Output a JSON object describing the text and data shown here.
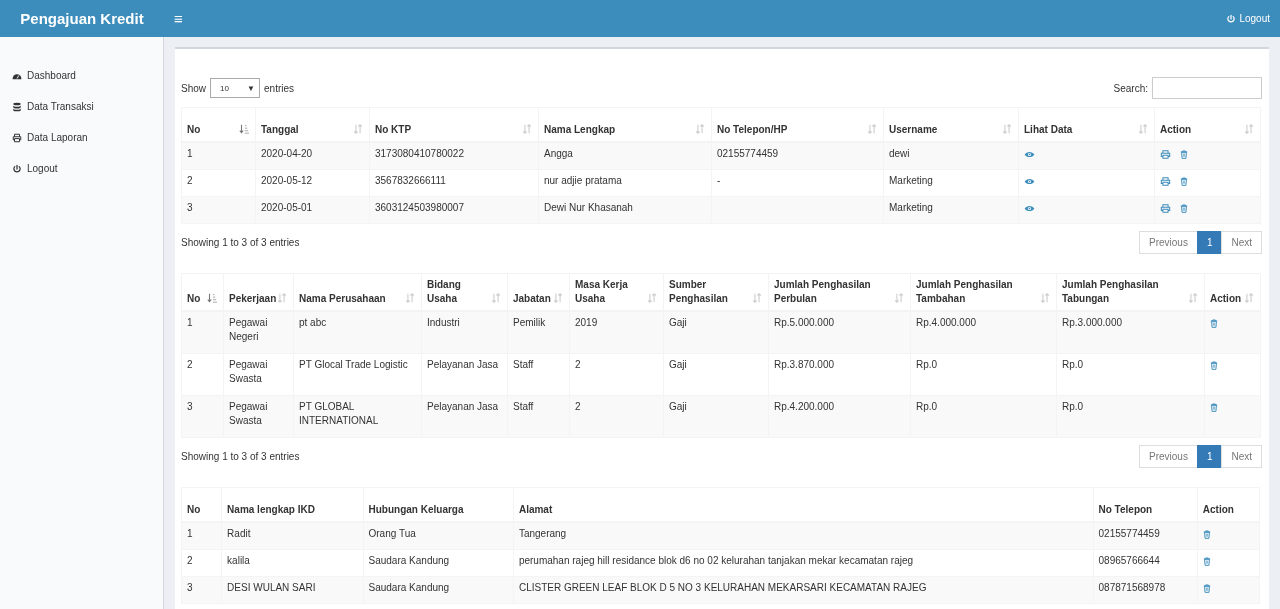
{
  "header": {
    "brand": "Pengajuan Kredit",
    "menu_toggle": "≡",
    "logout": "Logout"
  },
  "sidebar": {
    "items": [
      {
        "label": "Dashboard"
      },
      {
        "label": "Data Transaksi"
      },
      {
        "label": "Data Laporan"
      },
      {
        "label": "Logout"
      }
    ]
  },
  "controls": {
    "show_label": "Show",
    "length_value": "10",
    "length_caret": "▼",
    "entries_label": "entries",
    "search_label": "Search:"
  },
  "tables": [
    {
      "columns": [
        {
          "label": "No",
          "sorted": true,
          "kind": "text"
        },
        {
          "label": "Tanggal",
          "sorted": false,
          "kind": "text"
        },
        {
          "label": "No KTP",
          "sorted": false,
          "kind": "text"
        },
        {
          "label": "Nama Lengkap",
          "sorted": false,
          "kind": "text"
        },
        {
          "label": "No Telepon/HP",
          "sorted": false,
          "kind": "text"
        },
        {
          "label": "Username",
          "sorted": false,
          "kind": "text"
        },
        {
          "label": "Lihat Data",
          "sorted": false,
          "kind": "view"
        },
        {
          "label": "Action",
          "sorted": false,
          "kind": "print_delete"
        }
      ],
      "rows": [
        [
          "1",
          "2020-04-20",
          "3173080410780022",
          "Angga",
          "02155774459",
          "dewi"
        ],
        [
          "2",
          "2020-05-12",
          "3567832666111",
          "nur adjie pratama",
          "-",
          "Marketing"
        ],
        [
          "3",
          "2020-05-01",
          "3603124503980007",
          "Dewi Nur Khasanah",
          null,
          "Marketing"
        ]
      ],
      "info": "Showing 1 to 3 of 3 entries",
      "pagination": {
        "previous": {
          "label": "Previous",
          "disabled": true
        },
        "pages": [
          {
            "label": "1",
            "selected": true
          }
        ],
        "next": {
          "label": "Next",
          "disabled": true
        }
      }
    },
    {
      "columns": [
        {
          "label": "No",
          "sorted": true,
          "kind": "text"
        },
        {
          "label": "Pekerjaan",
          "sorted": false,
          "kind": "text"
        },
        {
          "label": "Nama Perusahaan",
          "sorted": false,
          "kind": "text"
        },
        {
          "label": "Bidang Usaha",
          "sorted": false,
          "kind": "text"
        },
        {
          "label": "Jabatan",
          "sorted": false,
          "kind": "text"
        },
        {
          "label": "Masa Kerja Usaha",
          "sorted": false,
          "kind": "text"
        },
        {
          "label": "Sumber Penghasilan",
          "sorted": false,
          "kind": "text"
        },
        {
          "label": "Jumlah Penghasilan Perbulan",
          "sorted": false,
          "kind": "text"
        },
        {
          "label": "Jumlah Penghasilan Tambahan",
          "sorted": false,
          "kind": "text"
        },
        {
          "label": "Jumlah Penghasilan Tabungan",
          "sorted": false,
          "kind": "text"
        },
        {
          "label": "Action",
          "sorted": false,
          "kind": "delete"
        }
      ],
      "rows": [
        [
          "1",
          "Pegawai Negeri",
          "pt abc",
          "Industri",
          "Pemilik",
          "2019",
          "Gaji",
          "Rp.5.000.000",
          "Rp.4.000.000",
          "Rp.3.000.000"
        ],
        [
          "2",
          "Pegawai Swasta",
          "PT Glocal Trade Logistic",
          "Pelayanan Jasa",
          "Staff",
          "2",
          "Gaji",
          "Rp.3.870.000",
          "Rp.0",
          "Rp.0"
        ],
        [
          "3",
          "Pegawai Swasta",
          "PT GLOBAL INTERNATIONAL",
          "Pelayanan Jasa",
          "Staff",
          "2",
          "Gaji",
          "Rp.4.200.000",
          "Rp.0",
          "Rp.0"
        ]
      ],
      "info": "Showing 1 to 3 of 3 entries",
      "pagination": {
        "previous": {
          "label": "Previous",
          "disabled": true
        },
        "pages": [
          {
            "label": "1",
            "selected": true
          }
        ],
        "next": {
          "label": "Next",
          "disabled": true
        }
      }
    },
    {
      "columns": [
        {
          "label": "No",
          "kind": "text"
        },
        {
          "label": "Nama lengkap IKD",
          "kind": "text"
        },
        {
          "label": "Hubungan Keluarga",
          "kind": "text"
        },
        {
          "label": "Alamat",
          "kind": "text"
        },
        {
          "label": "No Telepon",
          "kind": "text"
        },
        {
          "label": "Action",
          "kind": "delete"
        }
      ],
      "rows": [
        [
          "1",
          "Radit",
          "Orang Tua",
          "Tangerang",
          "02155774459"
        ],
        [
          "2",
          "kalila",
          "Saudara Kandung",
          "perumahan rajeg hill residance blok d6 no 02 kelurahan tanjakan mekar kecamatan rajeg",
          "08965766644"
        ],
        [
          "3",
          "DESI WULAN SARI",
          "Saudara Kandung",
          "CLISTER GREEN LEAF BLOK D 5 NO 3 KELURAHAN MEKARSARI KECAMATAN RAJEG",
          "087871568978"
        ]
      ]
    }
  ]
}
